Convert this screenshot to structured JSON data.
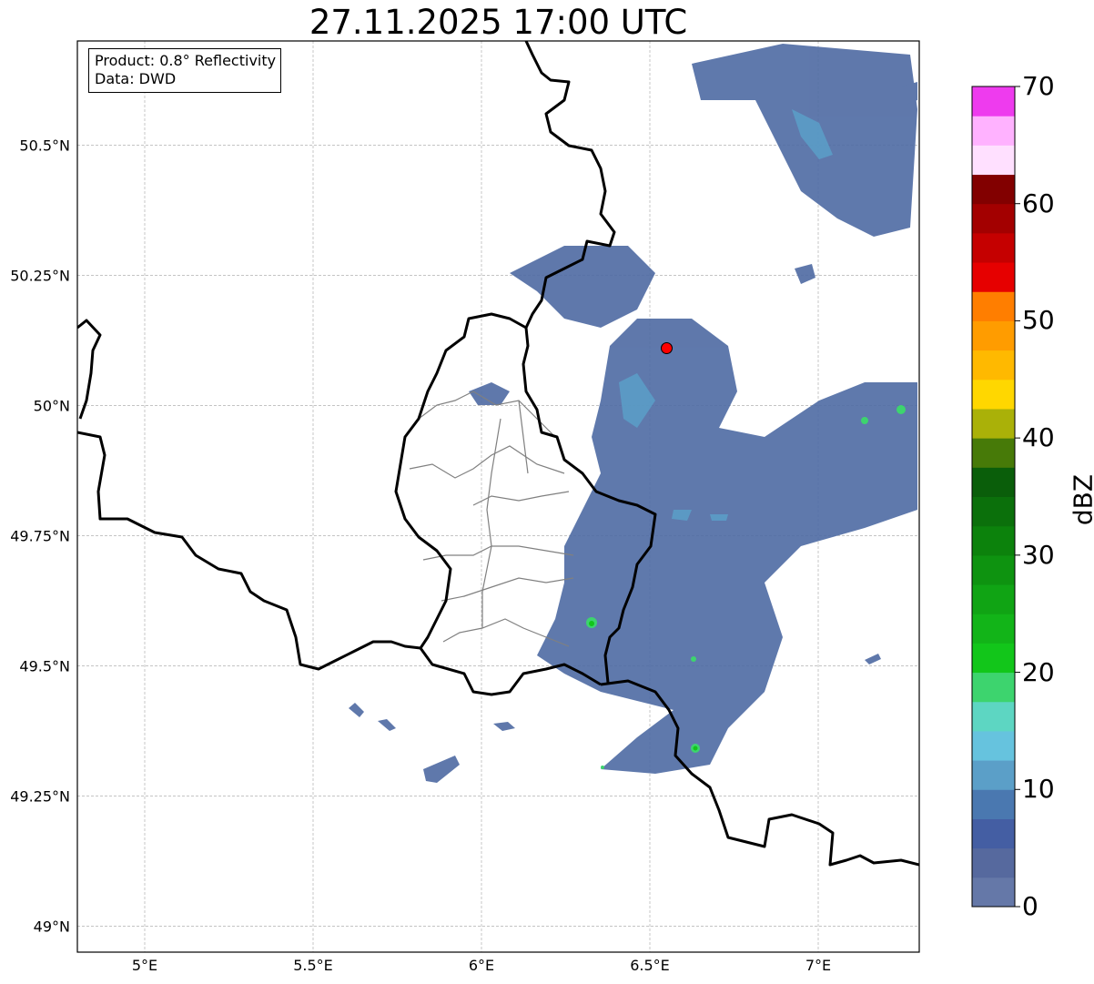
{
  "title": "27.11.2025 17:00 UTC",
  "legend_box": {
    "product": "Product: 0.8° Reflectivity",
    "data_source": "Data: DWD"
  },
  "map": {
    "lon_range": [
      4.8,
      7.3
    ],
    "lat_range": [
      48.95,
      50.7
    ],
    "grid": true,
    "x_ticks": [
      "5°E",
      "5.5°E",
      "6°E",
      "6.5°E",
      "7°E"
    ],
    "y_ticks": [
      "49°N",
      "49.25°N",
      "49.5°N",
      "49.75°N",
      "50°N",
      "50.25°N",
      "50.5°N"
    ],
    "radar_site": {
      "lon": 6.55,
      "lat": 50.11,
      "color": "#ff0000"
    }
  },
  "colorbar": {
    "label": "dBZ",
    "min": 0,
    "max": 70,
    "ticks": [
      "0",
      "10",
      "20",
      "30",
      "40",
      "50",
      "60",
      "70"
    ],
    "colors": [
      "#6578a8",
      "#56699e",
      "#445ea3",
      "#4a78b0",
      "#5b9fc8",
      "#66c3de",
      "#5dd6c2",
      "#3dd46e",
      "#12c61a",
      "#12b418",
      "#10a414",
      "#0e9310",
      "#0c820c",
      "#0b700b",
      "#0a5e0a",
      "#477a08",
      "#aab108",
      "#ffd700",
      "#ffb900",
      "#ff9c00",
      "#ff7e00",
      "#e60000",
      "#c50000",
      "#a30000",
      "#820000",
      "#ffe0ff",
      "#ffb2ff",
      "#ff73ff",
      "#ee3bee"
    ]
  }
}
